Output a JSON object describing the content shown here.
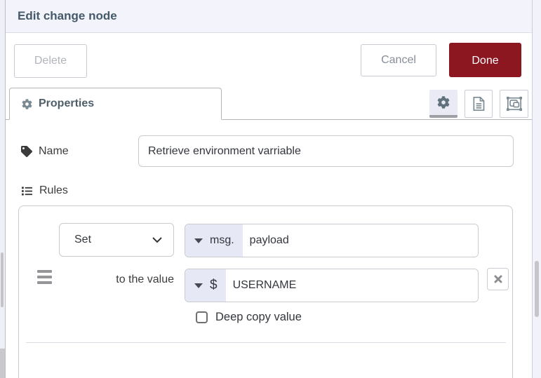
{
  "header": {
    "title": "Edit change node"
  },
  "toolbar": {
    "delete_label": "Delete",
    "cancel_label": "Cancel",
    "done_label": "Done"
  },
  "tabs": {
    "properties_label": "Properties"
  },
  "form": {
    "name_label": "Name",
    "name_value": "Retrieve environment varriable",
    "rules_label": "Rules",
    "rule": {
      "action_selected": "Set",
      "action_options": [
        "Set"
      ],
      "property_type_label": "msg.",
      "property_value": "payload",
      "to_label": "to the value",
      "value_type_label": "$",
      "value": "USERNAME",
      "deep_copy_label": "Deep copy value"
    }
  },
  "icons": {
    "tab_icon": "gear-icon",
    "toolbar_icons": [
      "gear-icon",
      "doc-icon",
      "appearance-icon"
    ],
    "name_icon": "tag-icon",
    "rules_icon": "list-icon",
    "remove_rule_icon": "close-icon",
    "reorder_icon": "drag-handle-icon",
    "expand_type_icon": "caret-down-icon"
  },
  "colors": {
    "accent_red": "#8c1721",
    "header_bg": "#f3f3fb",
    "title_text": "#44596a",
    "type_prefix_bg": "#e6e8f5",
    "border": "#c9c9d0",
    "selected_icon_bg": "#e9eaf4"
  }
}
